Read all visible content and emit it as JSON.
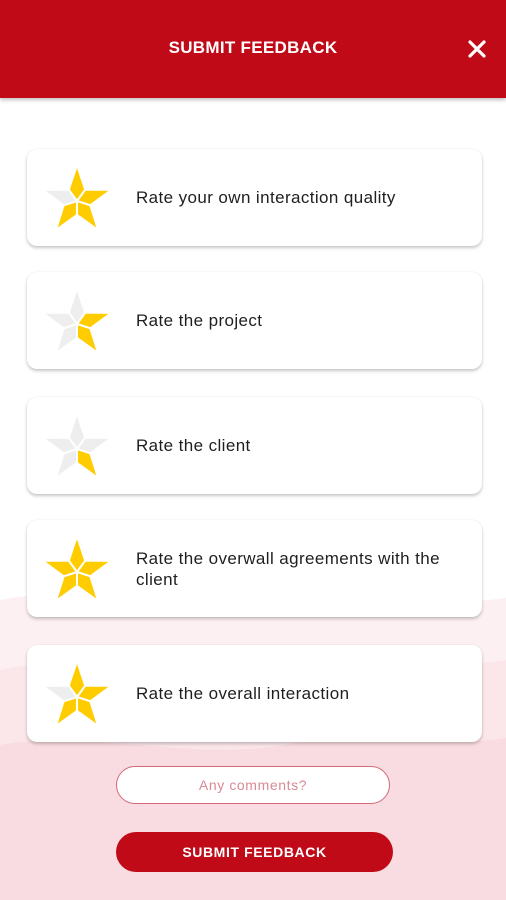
{
  "header": {
    "title": "SUBMIT FEEDBACK",
    "close_icon": "close-icon"
  },
  "ratings": [
    {
      "label": "Rate your own interaction quality",
      "icon": "star-rating-icon",
      "filled_segments": 4,
      "total_segments": 5
    },
    {
      "label": "Rate the project",
      "icon": "star-rating-icon",
      "filled_segments": 2,
      "total_segments": 5
    },
    {
      "label": "Rate the client",
      "icon": "star-rating-icon",
      "filled_segments": 1,
      "total_segments": 5
    },
    {
      "label": "Rate the overwall agreements with the client",
      "icon": "star-rating-icon",
      "filled_segments": 5,
      "total_segments": 5
    },
    {
      "label": "Rate the overall interaction",
      "icon": "star-rating-icon",
      "filled_segments": 4,
      "total_segments": 5
    }
  ],
  "comments": {
    "placeholder": "Any comments?"
  },
  "submit": {
    "label": "SUBMIT FEEDBACK"
  },
  "colors": {
    "brand": "#c00a18",
    "star_filled": "#ffcc00",
    "star_empty": "#eeeeee",
    "background_wave": "#fbe3e6"
  }
}
